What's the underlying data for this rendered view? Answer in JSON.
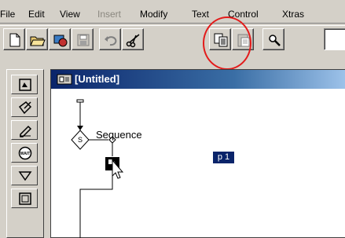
{
  "menubar": {
    "items": [
      {
        "label": "File",
        "enabled": true
      },
      {
        "label": "Edit",
        "enabled": true
      },
      {
        "label": "View",
        "enabled": true
      },
      {
        "label": "Insert",
        "enabled": false
      },
      {
        "label": "Modify",
        "enabled": true
      },
      {
        "label": "Text",
        "enabled": true
      },
      {
        "label": "Control",
        "enabled": true
      },
      {
        "label": "Xtras",
        "enabled": true
      }
    ]
  },
  "toolbar": {
    "buttons": [
      {
        "name": "new-file-icon"
      },
      {
        "name": "open-file-icon"
      },
      {
        "name": "import-icon"
      },
      {
        "name": "save-icon"
      },
      {
        "name": "undo-icon"
      },
      {
        "name": "cut-icon"
      },
      {
        "name": "copy-icon"
      },
      {
        "name": "paste-icon"
      },
      {
        "name": "find-icon"
      }
    ],
    "highlight_color": "#e31b1b"
  },
  "palette": {
    "tools": [
      "display-tool-icon",
      "motion-tool-icon",
      "erase-tool-icon",
      "wait-tool-icon",
      "decision-tool-icon",
      "framework-tool-icon"
    ]
  },
  "document": {
    "title": "[Untitled]",
    "titlebar_color": "#0a246a",
    "flowline": {
      "sequence_label": "Sequence",
      "sequence_icon_letter": "S",
      "selected_label": "p 1"
    }
  }
}
